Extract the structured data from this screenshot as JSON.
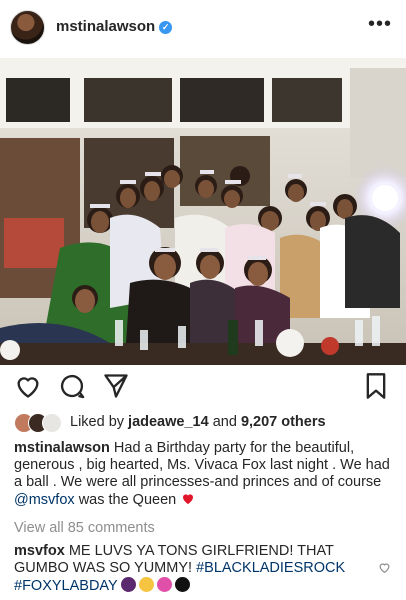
{
  "post": {
    "username": "mstinalawson",
    "more_icon": "more-horizontal-icon",
    "liked_by_prefix": "Liked by",
    "liked_by_user": "jadeawe_14",
    "liked_by_and": "and",
    "liked_by_others": "9,207 others",
    "caption_user": "mstinalawson",
    "caption_text_1": "Had a Birthday party for the beautiful, generous , big hearted, Ms. Vivaca Fox last night . We had a ball . We were all princesses-and princes and of course",
    "caption_mention": "@msvfox",
    "caption_text_2": "was the Queen",
    "view_all": "View all 85 comments",
    "comment_user": "msvfox",
    "comment_text": "ME LUVS YA TONS GIRLFRIEND! THAT GUMBO WAS SO YUMMY!",
    "comment_tag_1": "#BLACKLADIESROCK",
    "comment_tag_2": "#FOXYLABDAY"
  },
  "colors": {
    "link": "#003569",
    "muted": "#8e8e8e",
    "verified": "#3897f0",
    "heart": "#ed4956"
  },
  "icons": [
    "heart-icon",
    "comment-icon",
    "share-icon",
    "bookmark-icon",
    "verified-badge-icon"
  ]
}
